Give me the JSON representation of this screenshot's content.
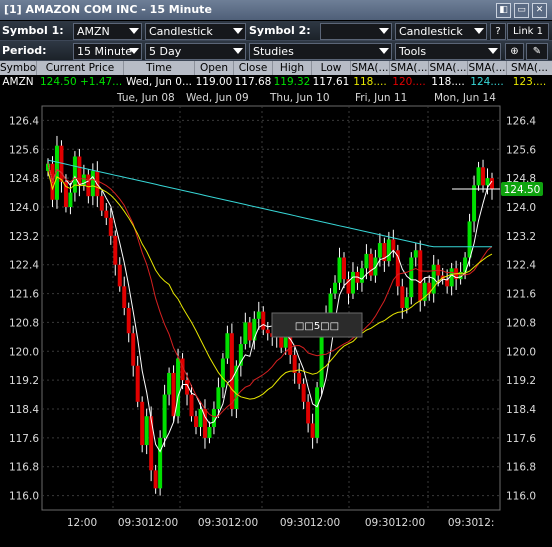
{
  "window": {
    "title": "[1] AMAZON COM INC - 15 Minute",
    "controls": [
      "◧",
      "▭",
      "✕"
    ]
  },
  "toolbar1": {
    "symbol1_label": "Symbol 1:",
    "symbol1_value": "AMZN",
    "charttype1_value": "Candlestick",
    "symbol2_label": "Symbol 2:",
    "symbol2_value": "",
    "charttype2_value": "Candlestick",
    "help_label": "?",
    "link_label": "Link 1"
  },
  "toolbar2": {
    "period_label": "Period:",
    "interval_value": "15 Minute",
    "range_value": "5 Day",
    "studies_value": "Studies",
    "tools_value": "Tools"
  },
  "quote": {
    "headers": [
      "Symbol",
      "Current Price",
      "Time",
      "Open",
      "Close",
      "High",
      "Low",
      "SMA(...",
      "SMA(...",
      "SMA(...",
      "SMA(...",
      "SMA(..."
    ],
    "symbol": "AMZN",
    "price": "124.50",
    "change": "+1.47...",
    "time": "Wed, Jun 0...",
    "open": "119.00",
    "close": "117.68",
    "high": "119.32",
    "low": "117.61",
    "sma1": "118....",
    "sma2": "120....",
    "sma3": "118....",
    "sma4": "124....",
    "sma5": "123...."
  },
  "dates": [
    "Tue, Jun 08",
    "Wed, Jun 09",
    "Thu, Jun 10",
    "Fri, Jun 11",
    "Mon, Jun 14"
  ],
  "time_labels": [
    "12:00",
    "09:30",
    "12:00",
    "09:30",
    "12:00",
    "09:30",
    "12:00",
    "09:30",
    "12:00",
    "09:30",
    "12:"
  ],
  "y_ticks": [
    "126.4",
    "125.6",
    "124.8",
    "124.0",
    "123.2",
    "122.4",
    "121.6",
    "120.8",
    "120.0",
    "119.2",
    "118.4",
    "117.6",
    "116.8",
    "116.0"
  ],
  "current_price_tag": "124.50",
  "tooltip_text": "□□5□□",
  "colors": {
    "up": "#00e000",
    "down": "#e00000",
    "sma_white": "#ffffff",
    "sma_yellow": "#e6e600",
    "sma_red": "#d42020",
    "sma_cyan": "#37d6d6"
  }
}
